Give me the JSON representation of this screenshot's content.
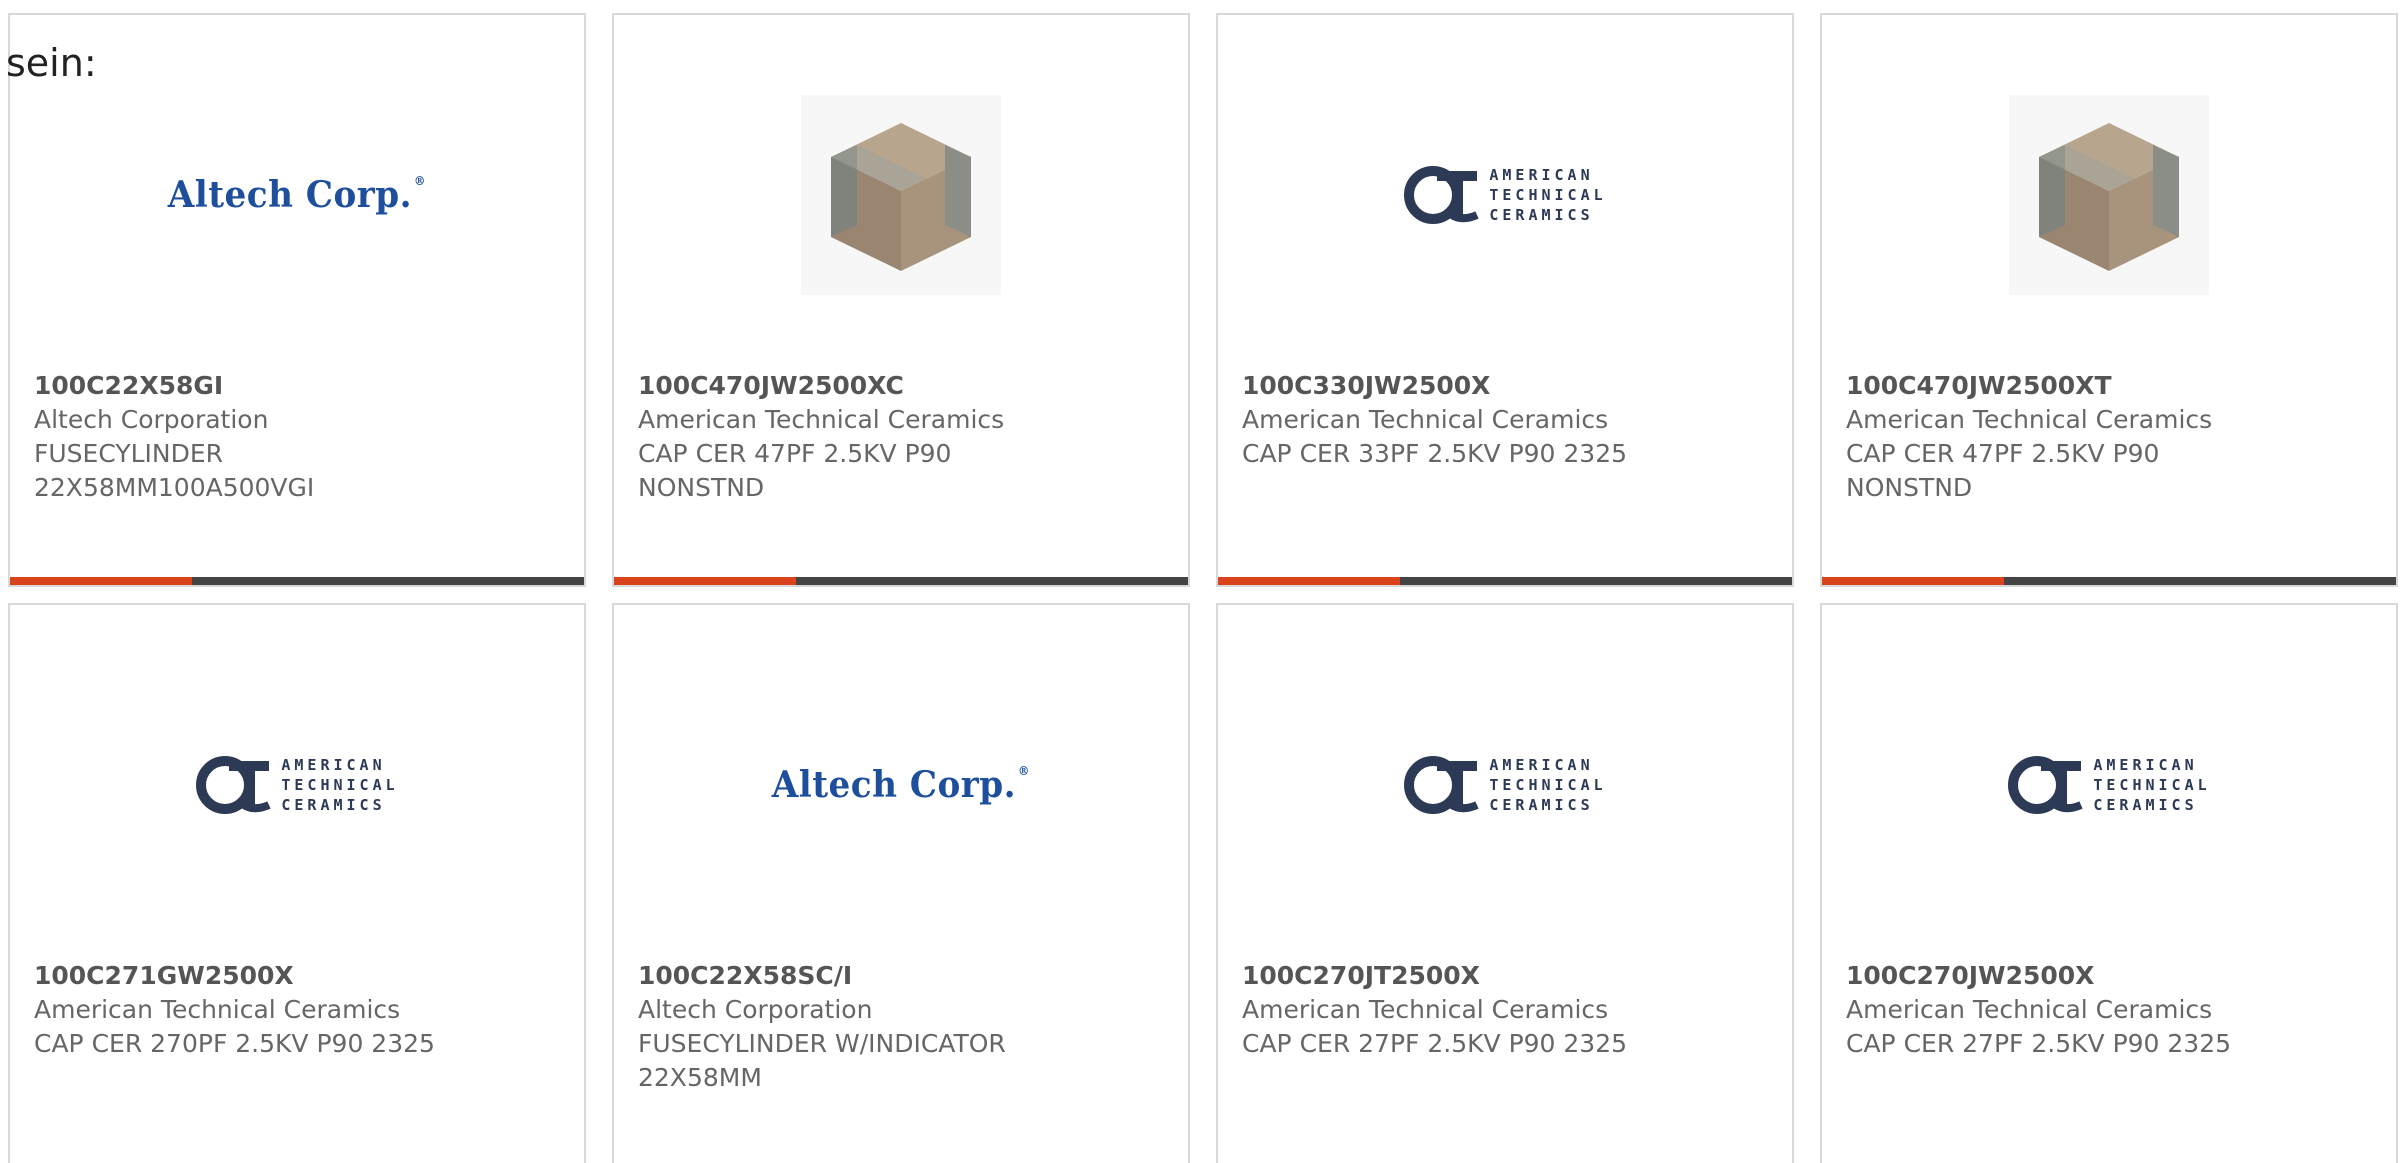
{
  "intro_text": "sein:",
  "logo_text": {
    "altech": "Altech Corp.",
    "altech_mark": "®",
    "atc_lines": [
      "AMERICAN",
      "TECHNICAL",
      "CERAMICS"
    ]
  },
  "colors": {
    "accent": "#d9421b",
    "bar": "#444444",
    "altech_blue": "#1d4f9c",
    "atc_blue": "#2c3a55"
  },
  "products": [
    {
      "part_number": "100C22X58GI",
      "manufacturer": "Altech Corporation",
      "description_lines": [
        "FUSECYLINDER",
        "22X58MM100A500VGI"
      ],
      "image": "altech-logo"
    },
    {
      "part_number": "100C470JW2500XC",
      "manufacturer": "American Technical Ceramics",
      "description_lines": [
        "CAP CER 47PF 2.5KV P90",
        "NONSTND"
      ],
      "image": "ceramic-capacitor-photo"
    },
    {
      "part_number": "100C330JW2500X",
      "manufacturer": "American Technical Ceramics",
      "description_lines": [
        "CAP CER 33PF 2.5KV P90 2325",
        ""
      ],
      "image": "atc-logo"
    },
    {
      "part_number": "100C470JW2500XT",
      "manufacturer": "American Technical Ceramics",
      "description_lines": [
        "CAP CER 47PF 2.5KV P90",
        "NONSTND"
      ],
      "image": "ceramic-capacitor-photo"
    },
    {
      "part_number": "100C271GW2500X",
      "manufacturer": "American Technical Ceramics",
      "description_lines": [
        "CAP CER 270PF 2.5KV P90 2325",
        ""
      ],
      "image": "atc-logo"
    },
    {
      "part_number": "100C22X58SC/I",
      "manufacturer": "Altech Corporation",
      "description_lines": [
        "FUSECYLINDER W/INDICATOR",
        "22X58MM"
      ],
      "image": "altech-logo"
    },
    {
      "part_number": "100C270JT2500X",
      "manufacturer": "American Technical Ceramics",
      "description_lines": [
        "CAP CER 27PF 2.5KV P90 2325",
        ""
      ],
      "image": "atc-logo"
    },
    {
      "part_number": "100C270JW2500X",
      "manufacturer": "American Technical Ceramics",
      "description_lines": [
        "CAP CER 27PF 2.5KV P90 2325",
        ""
      ],
      "image": "atc-logo"
    }
  ]
}
